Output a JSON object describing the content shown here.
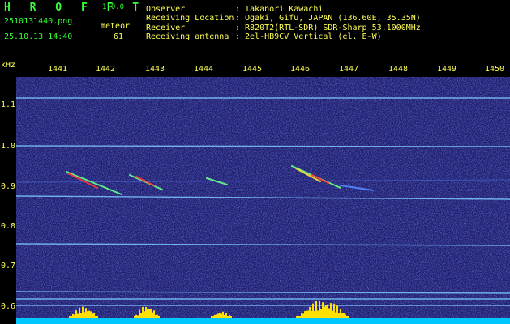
{
  "app": {
    "title": "H R O F F T",
    "version": "1.0.0",
    "filename": "2510131440.png",
    "timestamp": "25.10.13 14:40",
    "counter_label": "meteor",
    "counter_value": "61"
  },
  "info": [
    {
      "label": "Observer",
      "value": ": Takanori Kawachi"
    },
    {
      "label": "Receiving Location",
      "value": ": Ogaki, Gifu, JAPAN (136.60E, 35.35N)"
    },
    {
      "label": "Receiver",
      "value": ": R820T2(RTL-SDR) SDR-Sharp 53.1000MHz"
    },
    {
      "label": "Receiving antenna",
      "value": ": 2el-HB9CV Vertical (el. E-W)"
    }
  ],
  "axes": {
    "y_unit": "kHz",
    "x_ticks": [
      "1441",
      "1442",
      "1443",
      "1444",
      "1445",
      "1446",
      "1447",
      "1448",
      "1449",
      "1450"
    ],
    "y_ticks": [
      "1.1",
      "1.0",
      "0.9",
      "0.8",
      "0.7",
      "0.6"
    ]
  },
  "colors": {
    "background": "#1e1e6e",
    "carrier": "#7ec8ff",
    "label": "#ffff55",
    "histogram": "#ffe000",
    "baseline": "#00c8ff"
  }
}
